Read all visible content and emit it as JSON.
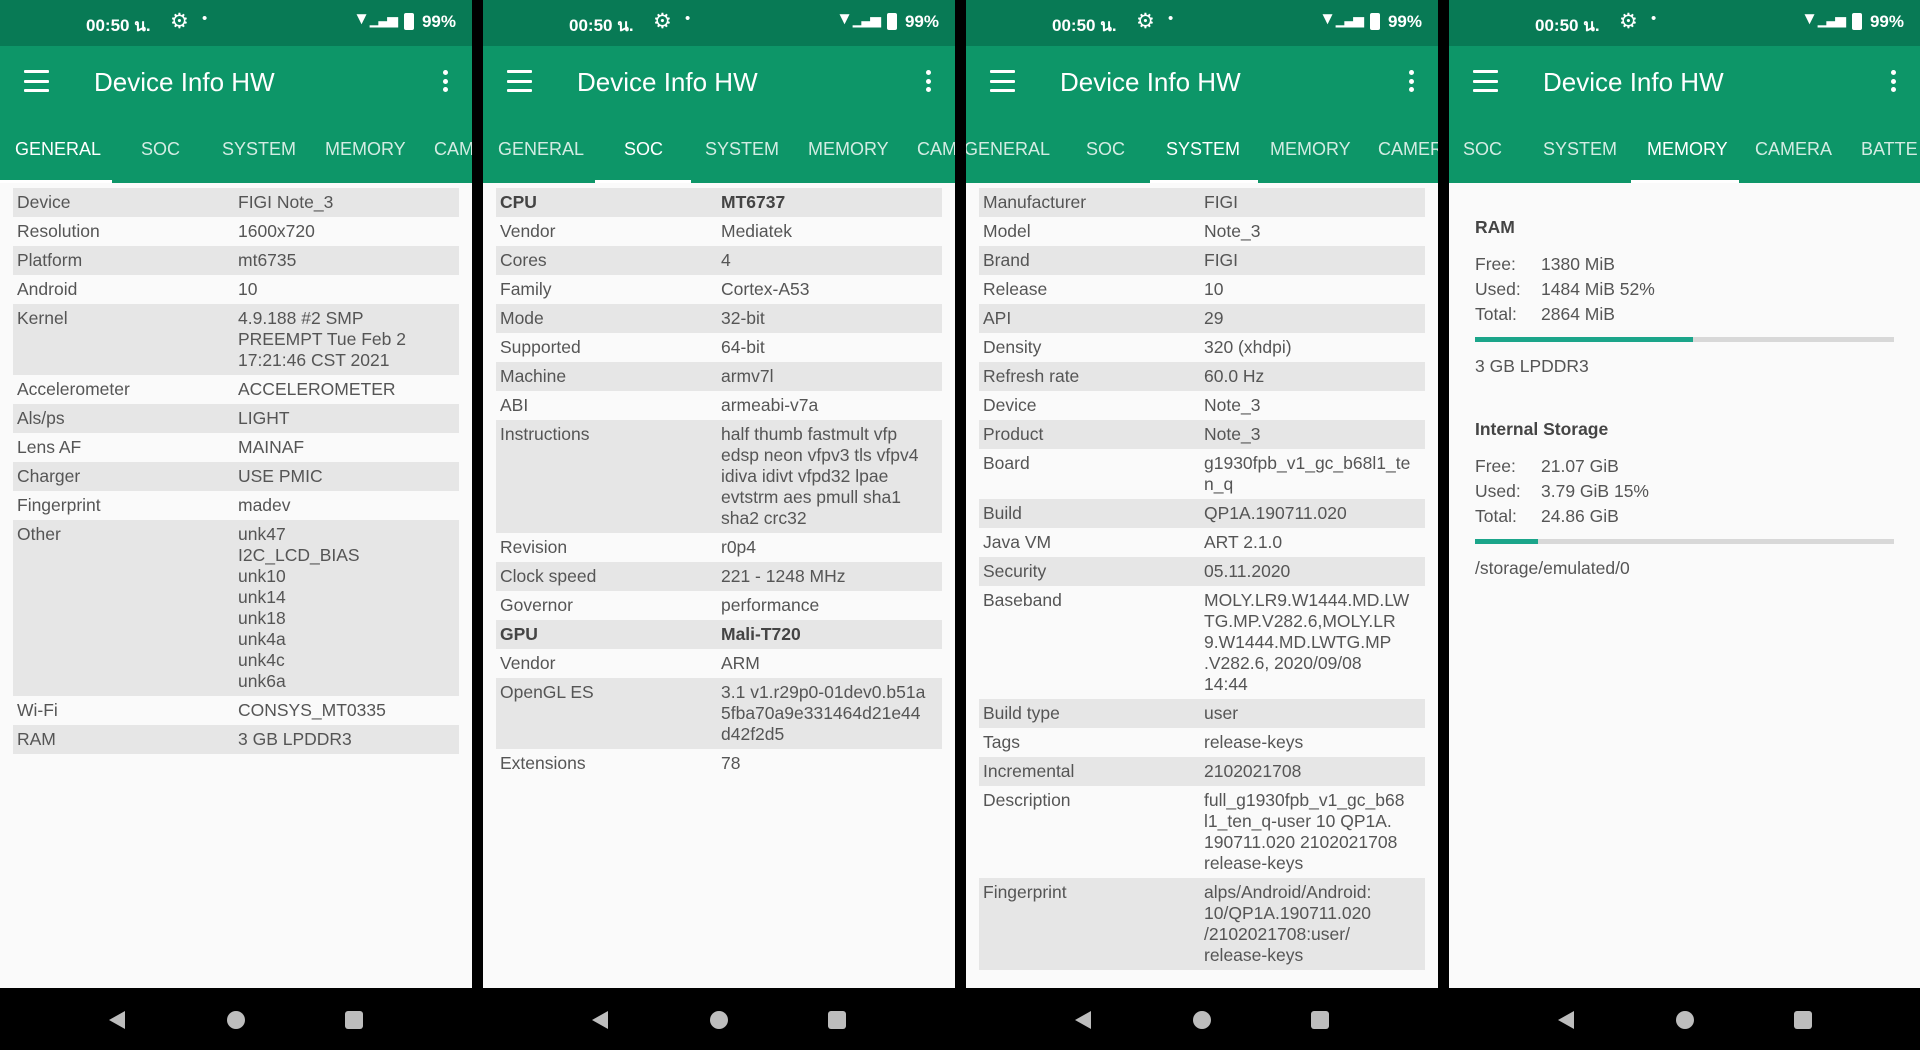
{
  "status": {
    "time": "00:50 น.",
    "battery": "99%"
  },
  "app_title": "Device Info HW",
  "colors": {
    "primary": "#0d9668",
    "status": "#087a55",
    "progress": "#1ba58a"
  },
  "screens": [
    {
      "tabs": [
        "GENERAL",
        "SOC",
        "SYSTEM",
        "MEMORY",
        "CAM"
      ],
      "active_tab": "GENERAL",
      "rows": [
        {
          "k": "Device",
          "v": "FIGI Note_3"
        },
        {
          "k": "Resolution",
          "v": "1600x720"
        },
        {
          "k": "Platform",
          "v": "mt6735"
        },
        {
          "k": "Android",
          "v": "10"
        },
        {
          "k": "Kernel",
          "v": "4.9.188 #2 SMP\nPREEMPT Tue Feb 2\n17:21:46 CST 2021"
        },
        {
          "k": "Accelerometer",
          "v": "ACCELEROMETER"
        },
        {
          "k": "Als/ps",
          "v": "LIGHT"
        },
        {
          "k": "Lens AF",
          "v": "MAINAF"
        },
        {
          "k": "Charger",
          "v": "USE PMIC"
        },
        {
          "k": "Fingerprint",
          "v": "madev"
        },
        {
          "k": "Other",
          "v": "unk47\nI2C_LCD_BIAS\nunk10\nunk14\nunk18\nunk4a\nunk4c\nunk6a"
        },
        {
          "k": "Wi-Fi",
          "v": "CONSYS_MT0335"
        },
        {
          "k": "RAM",
          "v": "3 GB LPDDR3"
        }
      ]
    },
    {
      "tabs": [
        "GENERAL",
        "SOC",
        "SYSTEM",
        "MEMORY",
        "CAM"
      ],
      "active_tab": "SOC",
      "rows": [
        {
          "k": "CPU",
          "v": "MT6737",
          "bold": true
        },
        {
          "k": "Vendor",
          "v": "Mediatek"
        },
        {
          "k": "Cores",
          "v": "4"
        },
        {
          "k": "Family",
          "v": "Cortex-A53"
        },
        {
          "k": "Mode",
          "v": "32-bit"
        },
        {
          "k": "Supported",
          "v": "64-bit"
        },
        {
          "k": "Machine",
          "v": "armv7l"
        },
        {
          "k": "ABI",
          "v": "armeabi-v7a"
        },
        {
          "k": "Instructions",
          "v": "half thumb fastmult vfp\nedsp neon vfpv3 tls vfpv4\nidiva idivt vfpd32 lpae\nevtstrm aes pmull sha1\nsha2 crc32"
        },
        {
          "k": "Revision",
          "v": "r0p4"
        },
        {
          "k": "Clock speed",
          "v": "221 - 1248 MHz"
        },
        {
          "k": "Governor",
          "v": "performance"
        },
        {
          "k": "GPU",
          "v": "Mali-T720",
          "bold": true
        },
        {
          "k": "Vendor",
          "v": "ARM"
        },
        {
          "k": "OpenGL ES",
          "v": "3.1 v1.r29p0-01dev0.b51a\n5fba70a9e331464d21e44\nd42f2d5"
        },
        {
          "k": "Extensions",
          "v": "78"
        }
      ]
    },
    {
      "tabs": [
        "GENERAL",
        "SOC",
        "SYSTEM",
        "MEMORY",
        "CAMER"
      ],
      "active_tab": "SYSTEM",
      "rows": [
        {
          "k": "Manufacturer",
          "v": "FIGI"
        },
        {
          "k": "Model",
          "v": "Note_3"
        },
        {
          "k": "Brand",
          "v": "FIGI"
        },
        {
          "k": "Release",
          "v": "10"
        },
        {
          "k": "API",
          "v": "29"
        },
        {
          "k": "Density",
          "v": "320 (xhdpi)"
        },
        {
          "k": "Refresh rate",
          "v": "60.0 Hz"
        },
        {
          "k": "Device",
          "v": "Note_3"
        },
        {
          "k": "Product",
          "v": "Note_3"
        },
        {
          "k": "Board",
          "v": "g1930fpb_v1_gc_b68l1_te\nn_q"
        },
        {
          "k": "Build",
          "v": "QP1A.190711.020"
        },
        {
          "k": "Java VM",
          "v": "ART 2.1.0"
        },
        {
          "k": "Security",
          "v": "05.11.2020"
        },
        {
          "k": "Baseband",
          "v": "MOLY.LR9.W1444.MD.LW\nTG.MP.V282.6,MOLY.LR\n9.W1444.MD.LWTG.MP\n.V282.6, 2020/09/08\n14:44"
        },
        {
          "k": "Build type",
          "v": "user"
        },
        {
          "k": "Tags",
          "v": "release-keys"
        },
        {
          "k": "Incremental",
          "v": "2102021708"
        },
        {
          "k": "Description",
          "v": "full_g1930fpb_v1_gc_b68\nl1_ten_q-user 10 QP1A.\n190711.020 2102021708\nrelease-keys"
        },
        {
          "k": "Fingerprint",
          "v": "alps/Android/Android:\n10/QP1A.190711.020\n/2102021708:user/\nrelease-keys"
        }
      ]
    },
    {
      "tabs": [
        "SOC",
        "SYSTEM",
        "MEMORY",
        "CAMERA",
        "BATTE"
      ],
      "active_tab": "MEMORY",
      "ram": {
        "title": "RAM",
        "free_label": "Free:",
        "free": "1380 MiB",
        "used_label": "Used:",
        "used": "1484 MiB 52%",
        "total_label": "Total:",
        "total": "2864 MiB",
        "used_fraction": 0.52,
        "type": "3 GB LPDDR3"
      },
      "storage": {
        "title": "Internal Storage",
        "free_label": "Free:",
        "free": "21.07 GiB",
        "used_label": "Used:",
        "used": "3.79 GiB 15%",
        "total_label": "Total:",
        "total": "24.86 GiB",
        "used_fraction": 0.15,
        "path": "/storage/emulated/0"
      }
    }
  ]
}
